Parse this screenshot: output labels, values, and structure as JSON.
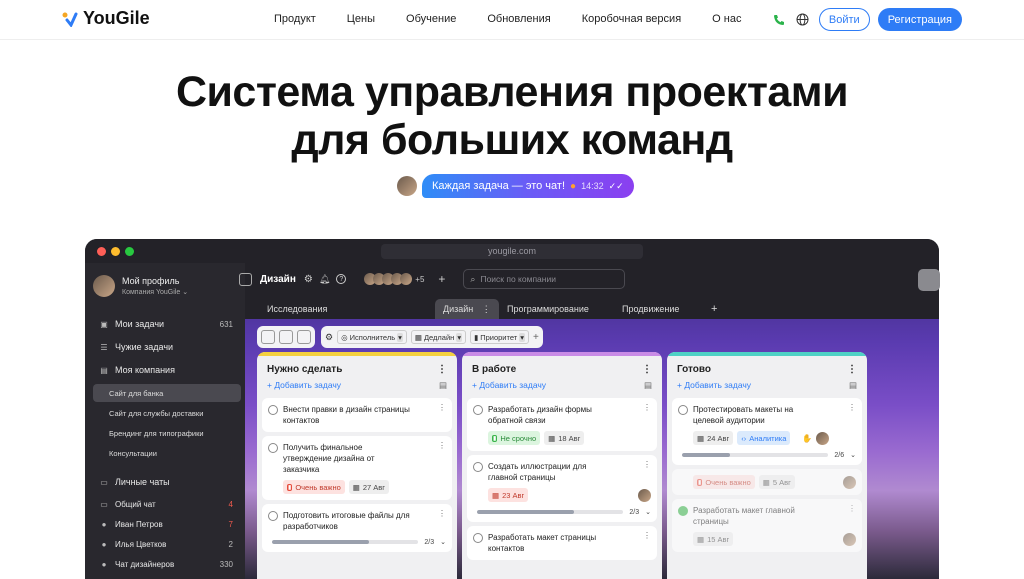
{
  "nav": {
    "logo": "YouGile",
    "menu": [
      "Продукт",
      "Цены",
      "Обучение",
      "Обновления",
      "Коробочная версия",
      "О нас"
    ],
    "login": "Войти",
    "register": "Регистрация"
  },
  "hero": {
    "line1": "Система управления проектами",
    "line2": "для больших команд"
  },
  "chat": {
    "text": "Каждая задача — это чат!",
    "time": "14:32"
  },
  "app": {
    "url": "yougile.com",
    "profile": {
      "name": "Мой профиль",
      "company": "Компания YouGile"
    },
    "sidebar": {
      "items": [
        {
          "label": "Мои задачи",
          "count": "631"
        },
        {
          "label": "Чужие задачи",
          "count": ""
        },
        {
          "label": "Моя компания",
          "count": ""
        }
      ],
      "projects": [
        "Сайт для банка",
        "Сайт для службы доставки",
        "Брендинг для типографики",
        "Консультации"
      ],
      "chats_title": "Личные чаты",
      "chats": [
        {
          "label": "Общий чат",
          "count": "4"
        },
        {
          "label": "Иван Петров",
          "count": "7"
        },
        {
          "label": "Илья Цветков",
          "count": "2"
        },
        {
          "label": "Чат дизайнеров",
          "count": "330"
        }
      ]
    },
    "board": {
      "title": "Дизайн",
      "members_more": "+5",
      "search_placeholder": "Поиск по компании",
      "tabs": [
        "Исследования",
        "Дизайн",
        "Программирование",
        "Продвижение"
      ],
      "filters": [
        "Исполнитель",
        "Дедлайн",
        "Приоритет"
      ],
      "add_task": "Добавить задачу",
      "columns": [
        {
          "title": "Нужно сделать",
          "color": "#f4d03f",
          "cards": [
            {
              "title": "Внести правки в дизайн страницы контактов"
            },
            {
              "title": "Получить финальное утверждение дизайна от заказчика",
              "tag": "Очень важно",
              "date": "27 Авг"
            },
            {
              "title": "Подготовить итоговые файлы для разработчиков",
              "progress": "2/3"
            }
          ]
        },
        {
          "title": "В работе",
          "color": "#c98be6",
          "cards": [
            {
              "title": "Разработать дизайн формы обратной связи",
              "tag": "Не срочно",
              "date": "18 Авг"
            },
            {
              "title": "Создать иллюстрации для главной страницы",
              "date": "23 Авг",
              "progress": "2/3"
            },
            {
              "title": "Разработать макет страницы контактов"
            }
          ]
        },
        {
          "title": "Готово",
          "color": "#4fd1c5",
          "cards": [
            {
              "title": "Протестировать макеты на целевой аудитории",
              "date": "24 Авг",
              "tag": "Аналитика",
              "progress": "2/6"
            },
            {
              "tag": "Очень важно",
              "date": "5 Авг"
            },
            {
              "title": "Разработать макет главной страницы",
              "date": "15 Авг"
            }
          ]
        }
      ]
    }
  }
}
